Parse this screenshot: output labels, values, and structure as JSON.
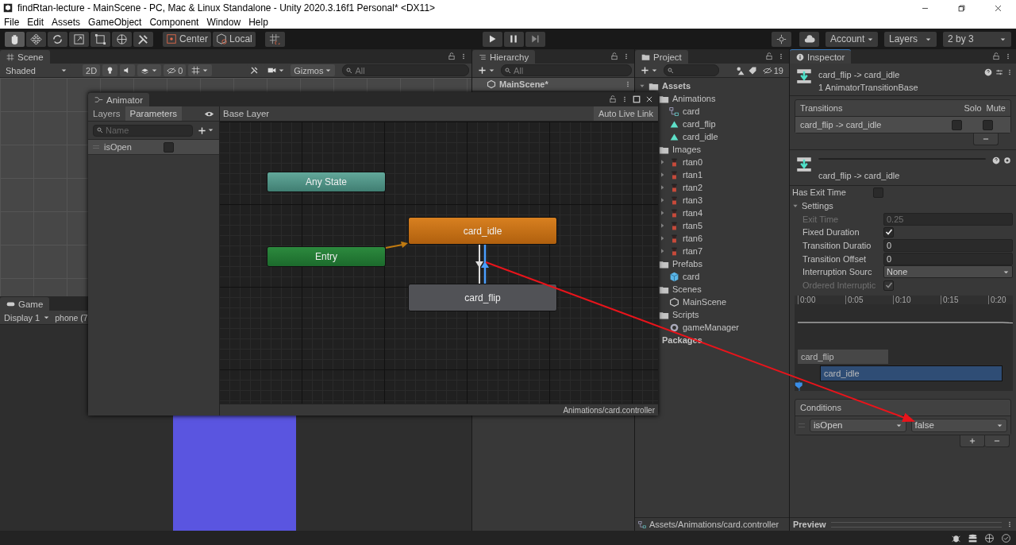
{
  "window": {
    "title": "findRtan-lecture - MainScene - PC, Mac & Linux Standalone - Unity 2020.3.16f1 Personal* <DX11>"
  },
  "menu": [
    "File",
    "Edit",
    "Assets",
    "GameObject",
    "Component",
    "Window",
    "Help"
  ],
  "toolbar": {
    "tools": [
      {
        "kind": "hand",
        "selected": true
      },
      {
        "kind": "move",
        "selected": false
      },
      {
        "kind": "rotate",
        "selected": false
      },
      {
        "kind": "scale",
        "selected": false
      },
      {
        "kind": "rect",
        "selected": false
      },
      {
        "kind": "transform",
        "selected": false
      },
      {
        "kind": "custom",
        "selected": false
      }
    ],
    "pivot": [
      {
        "kind": "center",
        "label": "Center"
      },
      {
        "kind": "local",
        "label": "Local"
      }
    ],
    "account": "Account",
    "layers": "Layers",
    "layout": "2 by 3"
  },
  "scene": {
    "tab": "Scene",
    "shading": "Shaded",
    "mode_2d": "2D",
    "hidden_count": "0",
    "gizmos": "Gizmos",
    "search_placeholder": "All"
  },
  "game": {
    "tab": "Game",
    "display": "Display 1",
    "resolution": "phone (7"
  },
  "hierarchy": {
    "tab": "Hierarchy",
    "search_placeholder": "All",
    "scene": "MainScene*"
  },
  "project": {
    "tab": "Project",
    "hidden_count": "19",
    "path": "Assets/Animations/card.controller",
    "tree": [
      {
        "label": "Assets",
        "kind": "root",
        "expanded": true,
        "children": [
          {
            "label": "Animations",
            "kind": "folder",
            "children": [
              {
                "label": "card",
                "kind": "controller"
              },
              {
                "label": "card_flip",
                "kind": "clip"
              },
              {
                "label": "card_idle",
                "kind": "clip"
              }
            ]
          },
          {
            "label": "Images",
            "kind": "folder",
            "children": [
              {
                "label": "rtan0",
                "kind": "sprite",
                "expanded": false
              },
              {
                "label": "rtan1",
                "kind": "sprite",
                "expanded": false
              },
              {
                "label": "rtan2",
                "kind": "sprite",
                "expanded": false
              },
              {
                "label": "rtan3",
                "kind": "sprite",
                "expanded": false
              },
              {
                "label": "rtan4",
                "kind": "sprite",
                "expanded": false
              },
              {
                "label": "rtan5",
                "kind": "sprite",
                "expanded": false
              },
              {
                "label": "rtan6",
                "kind": "sprite",
                "expanded": false
              },
              {
                "label": "rtan7",
                "kind": "sprite",
                "expanded": false
              }
            ]
          },
          {
            "label": "Prefabs",
            "kind": "folder",
            "children": [
              {
                "label": "card",
                "kind": "prefab"
              }
            ]
          },
          {
            "label": "Scenes",
            "kind": "folder",
            "children": [
              {
                "label": "MainScene",
                "kind": "scene"
              }
            ]
          },
          {
            "label": "Scripts",
            "kind": "folder",
            "children": [
              {
                "label": "gameManager",
                "kind": "script"
              }
            ]
          }
        ]
      },
      {
        "label": "Packages",
        "kind": "packages"
      }
    ]
  },
  "animator": {
    "tab": "Animator",
    "tabs": [
      {
        "label": "Layers",
        "selected": false
      },
      {
        "label": "Parameters",
        "selected": true
      }
    ],
    "search_placeholder": "Name",
    "parameters": [
      {
        "name": "isOpen",
        "checked": false
      }
    ],
    "breadcrumb": "Base Layer",
    "live_link": "Auto Live Link",
    "states": [
      {
        "name": "Any State",
        "kind": "any"
      },
      {
        "name": "Entry",
        "kind": "entry"
      },
      {
        "name": "card_idle",
        "kind": "default"
      },
      {
        "name": "card_flip",
        "kind": "normal"
      }
    ],
    "footer": "Animations/card.controller"
  },
  "inspector": {
    "tab": "Inspector",
    "title": "card_flip -> card_idle",
    "subtitle": "1 AnimatorTransitionBase",
    "transitions": {
      "header": "Transitions",
      "solo": "Solo",
      "mute": "Mute",
      "rows": [
        {
          "name": "card_flip -> card_idle",
          "solo": false,
          "mute": false
        }
      ]
    },
    "transition_name": "card_flip -> card_idle",
    "has_exit_time": {
      "label": "Has Exit Time",
      "checked": false
    },
    "settings": {
      "label": "Settings",
      "expanded": true,
      "fields": [
        {
          "label": "Exit Time",
          "kind": "number",
          "value": "0.25",
          "disabled": true
        },
        {
          "label": "Fixed Duration",
          "kind": "checkbox",
          "checked": true,
          "disabled": false
        },
        {
          "label": "Transition Duratio",
          "kind": "number",
          "value": "0",
          "disabled": false
        },
        {
          "label": "Transition Offset",
          "kind": "number",
          "value": "0",
          "disabled": false
        },
        {
          "label": "Interruption Sourc",
          "kind": "dropdown",
          "value": "None",
          "disabled": false
        },
        {
          "label": "Ordered Interruptic",
          "kind": "checkbox",
          "checked": true,
          "disabled": true
        }
      ]
    },
    "timeline": {
      "ticks": [
        "0:00",
        "0:05",
        "0:10",
        "0:15",
        "0:20"
      ],
      "clips": [
        {
          "name": "card_flip",
          "kind": "source"
        },
        {
          "name": "card_idle",
          "kind": "target"
        }
      ]
    },
    "conditions": {
      "header": "Conditions",
      "rows": [
        {
          "parameter": "isOpen",
          "value": "false"
        }
      ]
    },
    "preview": "Preview"
  }
}
